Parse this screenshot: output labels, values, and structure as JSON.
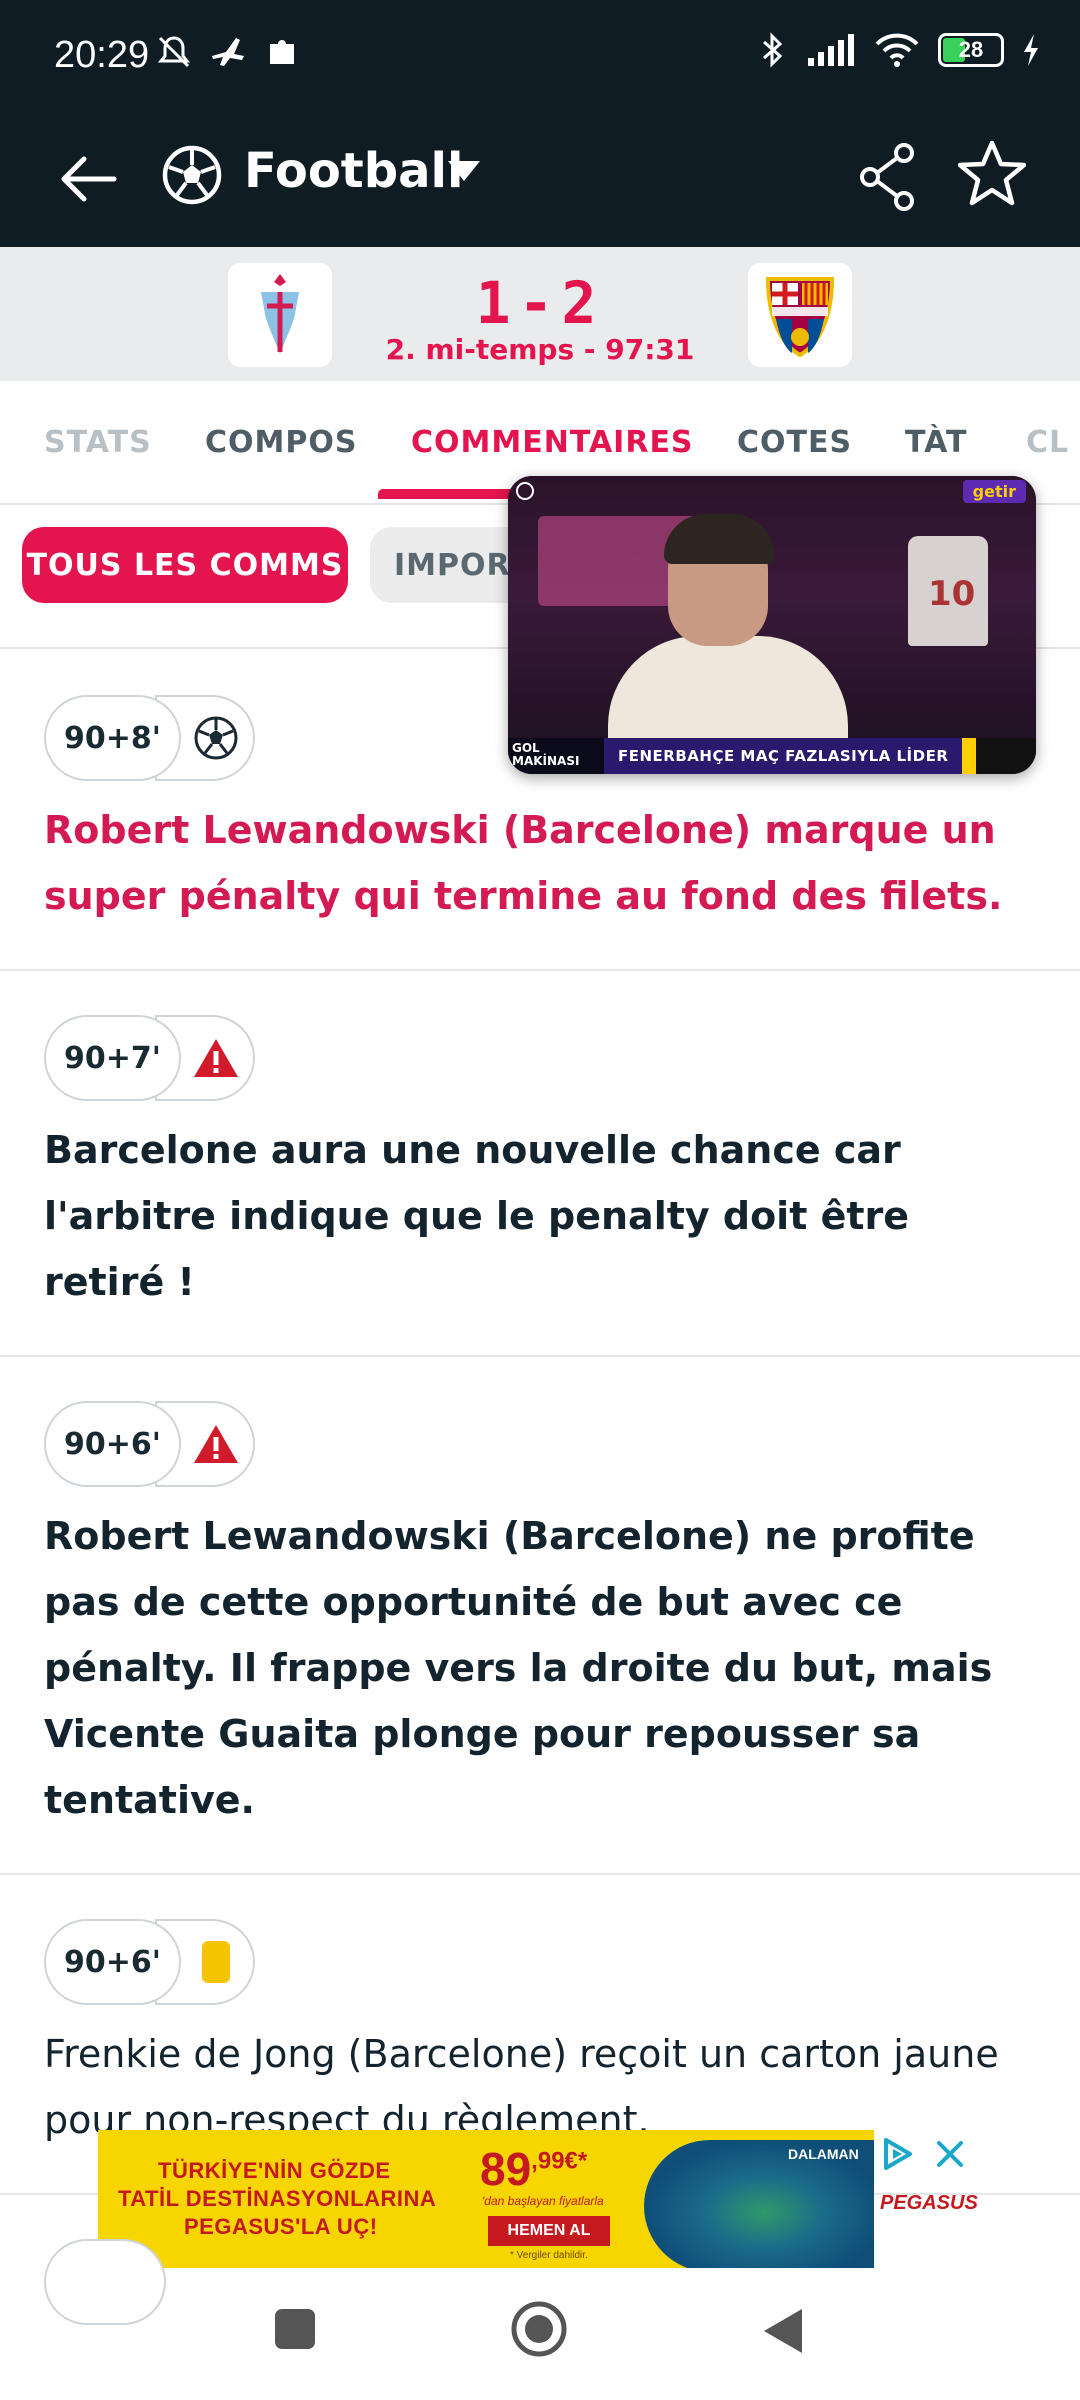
{
  "status_bar": {
    "time": "20:29",
    "battery": "28"
  },
  "app_bar": {
    "title": "Football"
  },
  "match": {
    "score": "1-2",
    "status": "2. mi-temps - 97:31"
  },
  "tabs": [
    {
      "label": "STATS"
    },
    {
      "label": "COMPOS"
    },
    {
      "label": "COMMENTAIRES"
    },
    {
      "label": "COTES"
    },
    {
      "label": "TÀT"
    },
    {
      "label": "CL"
    }
  ],
  "filters": {
    "all_label": "TOUS LES COMMS",
    "important_label": "IMPORTANTS"
  },
  "video": {
    "brand": "getir",
    "tag": "GOL MAKİNASI",
    "headline": "FENERBAHÇE MAÇ FAZLASIYLA LİDER",
    "jersey": "10"
  },
  "commentary": [
    {
      "minute": "90+8'",
      "icon": "goal-ball-icon",
      "text": "Robert Lewandowski (Barcelone) marque un super pénalty qui termine au fond des filets.",
      "style": "goal"
    },
    {
      "minute": "90+7'",
      "icon": "warning-icon",
      "text": "Barcelone aura une nouvelle chance car l'arbitre indique que le penalty doit être retiré !",
      "style": "bold"
    },
    {
      "minute": "90+6'",
      "icon": "warning-icon",
      "text": "Robert Lewandowski (Barcelone) ne profite pas de cette opportunité de but avec ce pénalty. Il frappe vers la droite du but, mais Vicente Guaita plonge pour repousser sa tentative.",
      "style": "bold"
    },
    {
      "minute": "90+6'",
      "icon": "yellow-card-icon",
      "text": "Frenkie de Jong (Barcelone) reçoit un carton jaune pour non-respect du règlement.",
      "style": "normal"
    }
  ],
  "ad": {
    "line1": "TÜRKİYE'NİN GÖZDE",
    "line2": "TATİL DESTİNASYONLARINA",
    "line3": "PEGASUS'LA UÇ!",
    "price": "89",
    "price_cents": ",99€*",
    "price_sub": "'dan başlayan fiyatlarla",
    "cta": "HEMEN AL",
    "fine_print": "* Vergiler dahildir.",
    "region": "DALAMAN",
    "brand": "PEGASUS"
  },
  "colors": {
    "accent": "#e3144e",
    "header_bg": "#0f1c24",
    "warning": "#d11a2a",
    "yellow_card": "#f5c400"
  }
}
